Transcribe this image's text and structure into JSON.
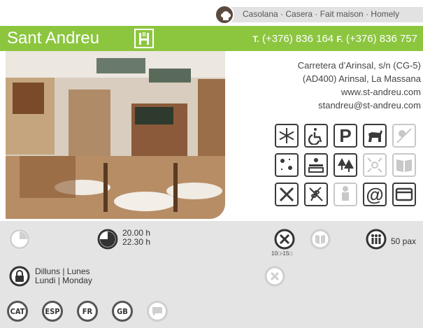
{
  "cuisine": {
    "text": "Casolana · Casera · Fait maison · Homely",
    "icon": "chef-hat-icon"
  },
  "header": {
    "name": "Sant Andreu",
    "hostal_icon": "hostal-h-icon",
    "tel_prefix": "T.",
    "tel": " (+376) 836 164 ",
    "fax_prefix": "F.",
    "fax": " (+376) 836 757",
    "color": "#8cc63f"
  },
  "contact": {
    "address_line1": "Carretera d’Arinsal, s/n (CG-5)",
    "address_line2": "(AD400) Arinsal, La Massana",
    "web": "www.st-andreu.com",
    "email": "standreu@st-andreu.com"
  },
  "amenities": [
    {
      "name": "air-conditioning-icon",
      "on": true
    },
    {
      "name": "wheelchair-accessible-icon",
      "on": true
    },
    {
      "name": "parking-icon",
      "on": true
    },
    {
      "name": "pets-allowed-icon",
      "on": true
    },
    {
      "name": "terrace-icon",
      "on": false
    },
    {
      "name": "outdoor-seating-icon",
      "on": true
    },
    {
      "name": "views-icon",
      "on": true
    },
    {
      "name": "nature-icon",
      "on": true
    },
    {
      "name": "center-icon",
      "on": false
    },
    {
      "name": "menu-book-icon",
      "on": false
    },
    {
      "name": "restaurant-icon",
      "on": true
    },
    {
      "name": "gluten-free-icon",
      "on": true
    },
    {
      "name": "chef-icon",
      "on": false
    },
    {
      "name": "email-at-icon",
      "on": true
    },
    {
      "name": "credit-card-icon",
      "on": true
    }
  ],
  "info": {
    "lunch_icon": "lunch-clock-icon",
    "hours_line1": "20.00 h",
    "hours_line2": "22.30 h",
    "price_range": "10□-15□",
    "capacity": "50 pax",
    "closed_line1": "Dilluns | Lunes",
    "closed_line2": "Lundi | Monday"
  },
  "languages": [
    {
      "label": "CAT",
      "on": true
    },
    {
      "label": "ESP",
      "on": true
    },
    {
      "label": "FR",
      "on": true
    },
    {
      "label": "GB",
      "on": true
    },
    {
      "label": "",
      "on": false
    }
  ]
}
